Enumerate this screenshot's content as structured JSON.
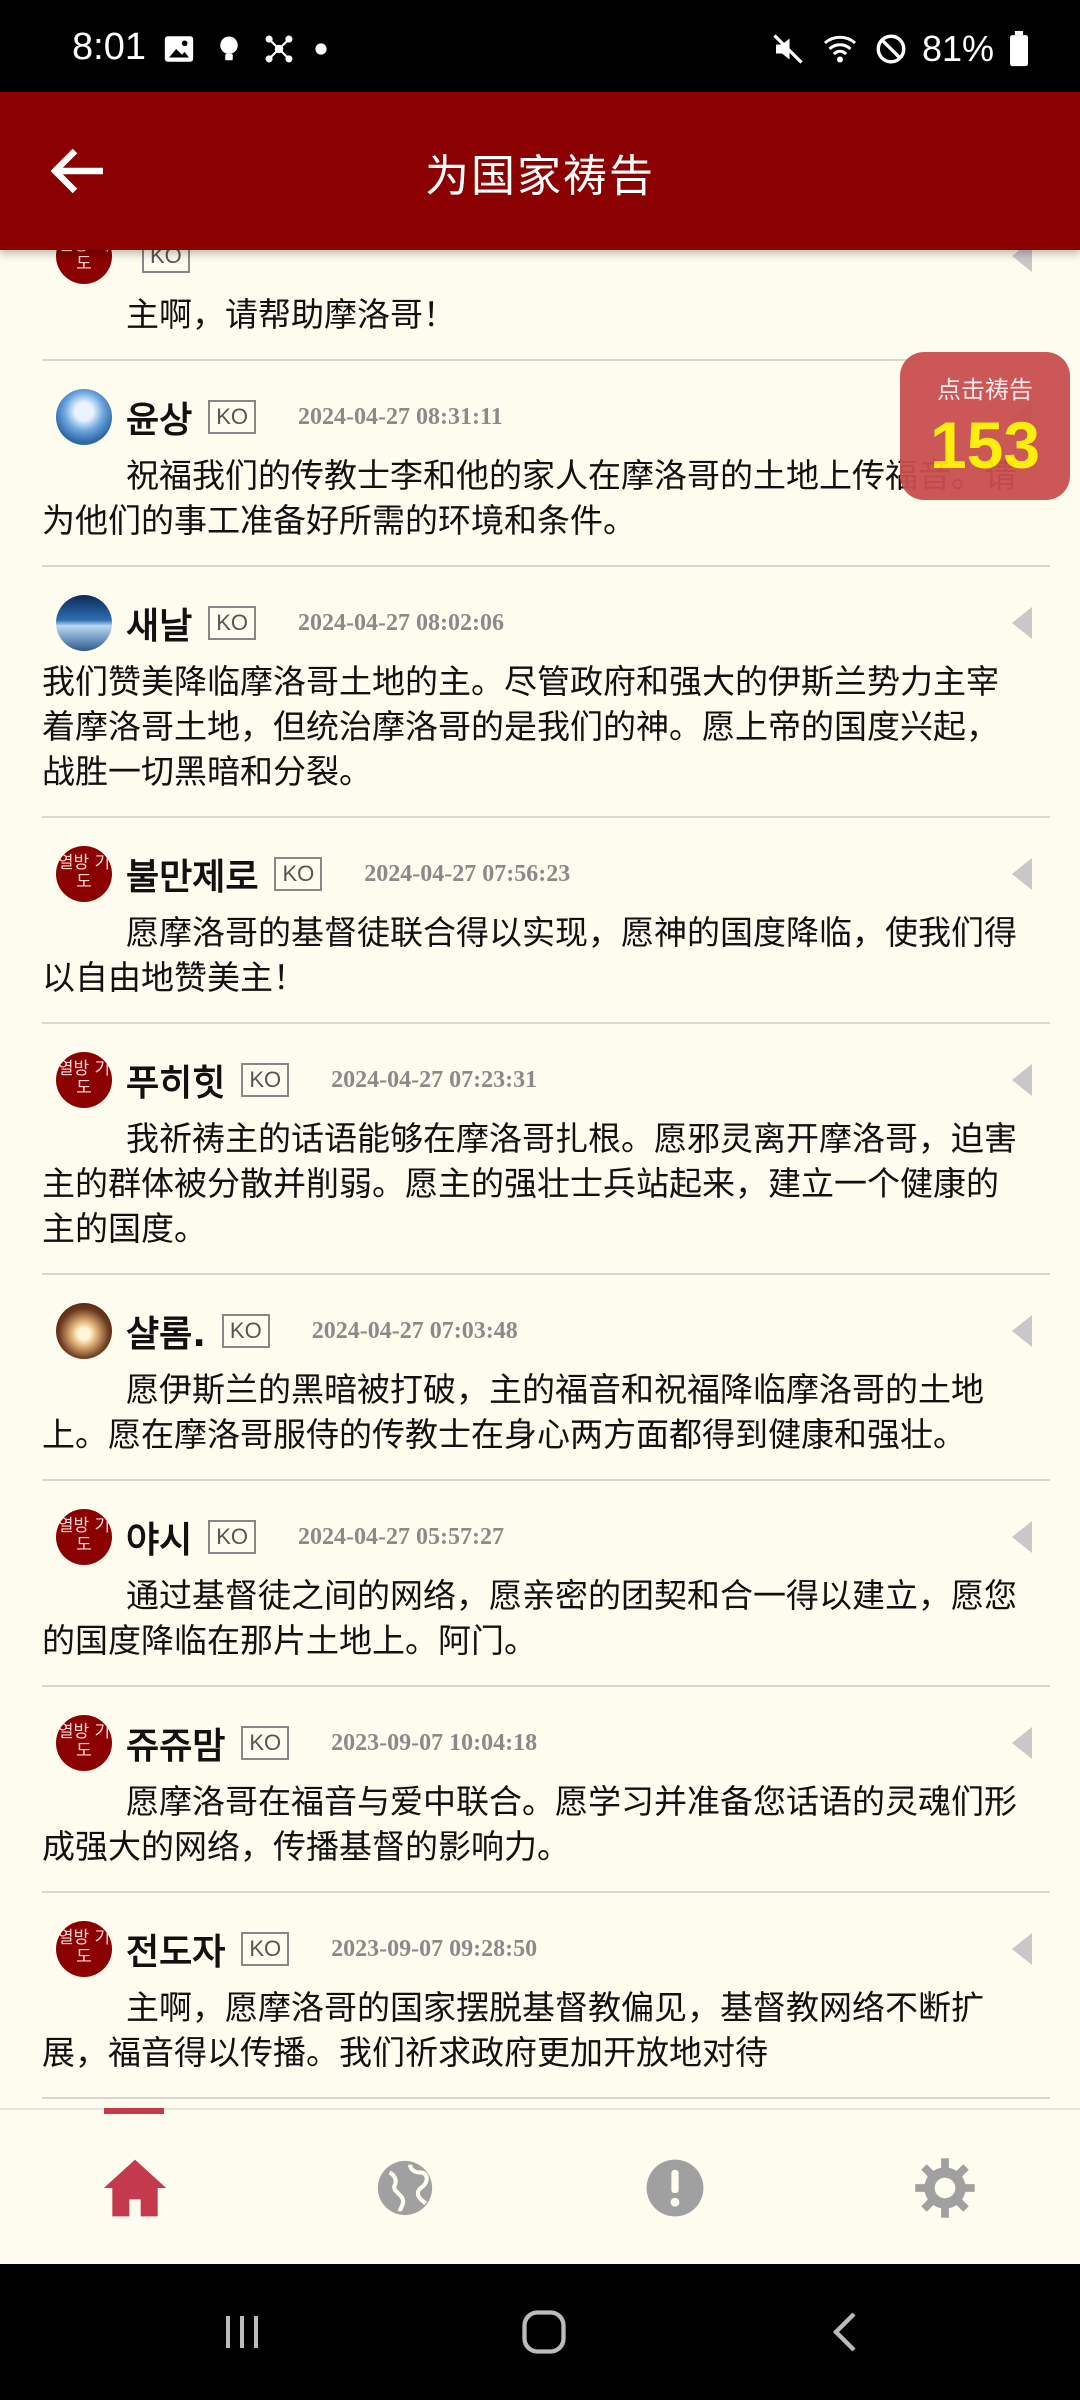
{
  "status_bar": {
    "time": "8:01",
    "battery": "81%"
  },
  "app_bar": {
    "title": "为国家祷告"
  },
  "counter": {
    "label": "点击祷告",
    "value": "153"
  },
  "prayers": [
    {
      "name": "",
      "lang": "KO",
      "date": "",
      "avatar": "seal",
      "avatar_text": "열방 기도",
      "text": "主啊，请帮助摩洛哥！"
    },
    {
      "name": "윤상",
      "lang": "KO",
      "date": "2024-04-27 08:31:11",
      "avatar": "photo1",
      "text": "祝福我们的传教士李和他的家人在摩洛哥的土地上传福音。请为他们的事工准备好所需的环境和条件。"
    },
    {
      "name": "새날",
      "lang": "KO",
      "date": "2024-04-27 08:02:06",
      "avatar": "photo2",
      "text": "我们赞美降临摩洛哥土地的主。尽管政府和强大的伊斯兰势力主宰着摩洛哥土地，但统治摩洛哥的是我们的神。愿上帝的国度兴起，战胜一切黑暗和分裂。"
    },
    {
      "name": "불만제로",
      "lang": "KO",
      "date": "2024-04-27 07:56:23",
      "avatar": "seal",
      "avatar_text": "열방 기도",
      "text": "愿摩洛哥的基督徒联合得以实现，愿神的国度降临，使我们得以自由地赞美主！"
    },
    {
      "name": "푸히힛",
      "lang": "KO",
      "date": "2024-04-27 07:23:31",
      "avatar": "seal",
      "avatar_text": "열방 기도",
      "text": "我祈祷主的话语能够在摩洛哥扎根。愿邪灵离开摩洛哥，迫害主的群体被分散并削弱。愿主的强壮士兵站起来，建立一个健康的主的国度。"
    },
    {
      "name": "샬롬.",
      "lang": "KO",
      "date": "2024-04-27 07:03:48",
      "avatar": "photo3",
      "text": "愿伊斯兰的黑暗被打破，主的福音和祝福降临摩洛哥的土地上。愿在摩洛哥服侍的传教士在身心两方面都得到健康和强壮。"
    },
    {
      "name": "야시",
      "lang": "KO",
      "date": "2024-04-27 05:57:27",
      "avatar": "seal",
      "avatar_text": "열방 기도",
      "text": "通过基督徒之间的网络，愿亲密的团契和合一得以建立，愿您的国度降临在那片土地上。阿门。"
    },
    {
      "name": "쥬쥬맘",
      "lang": "KO",
      "date": "2023-09-07 10:04:18",
      "avatar": "seal",
      "avatar_text": "열방 기도",
      "text": "愿摩洛哥在福音与爱中联合。愿学习并准备您话语的灵魂们形成强大的网络，传播基督的影响力。"
    },
    {
      "name": "전도자",
      "lang": "KO",
      "date": "2023-09-07 09:28:50",
      "avatar": "seal",
      "avatar_text": "열방 기도",
      "text": "主啊，愿摩洛哥的国家摆脱基督教偏见，基督教网络不断扩展，福音得以传播。我们祈求政府更加开放地对待"
    }
  ],
  "nav": {
    "items": [
      "home-icon",
      "globe-icon",
      "alert-icon",
      "settings-icon"
    ],
    "active_color": "#c43a4c",
    "inactive_color": "#a0a0a0"
  },
  "colors": {
    "app_bar": "#8b0000",
    "background": "#fdfcee",
    "counter_bg": "#c94f4f",
    "counter_value": "#ffee00"
  }
}
